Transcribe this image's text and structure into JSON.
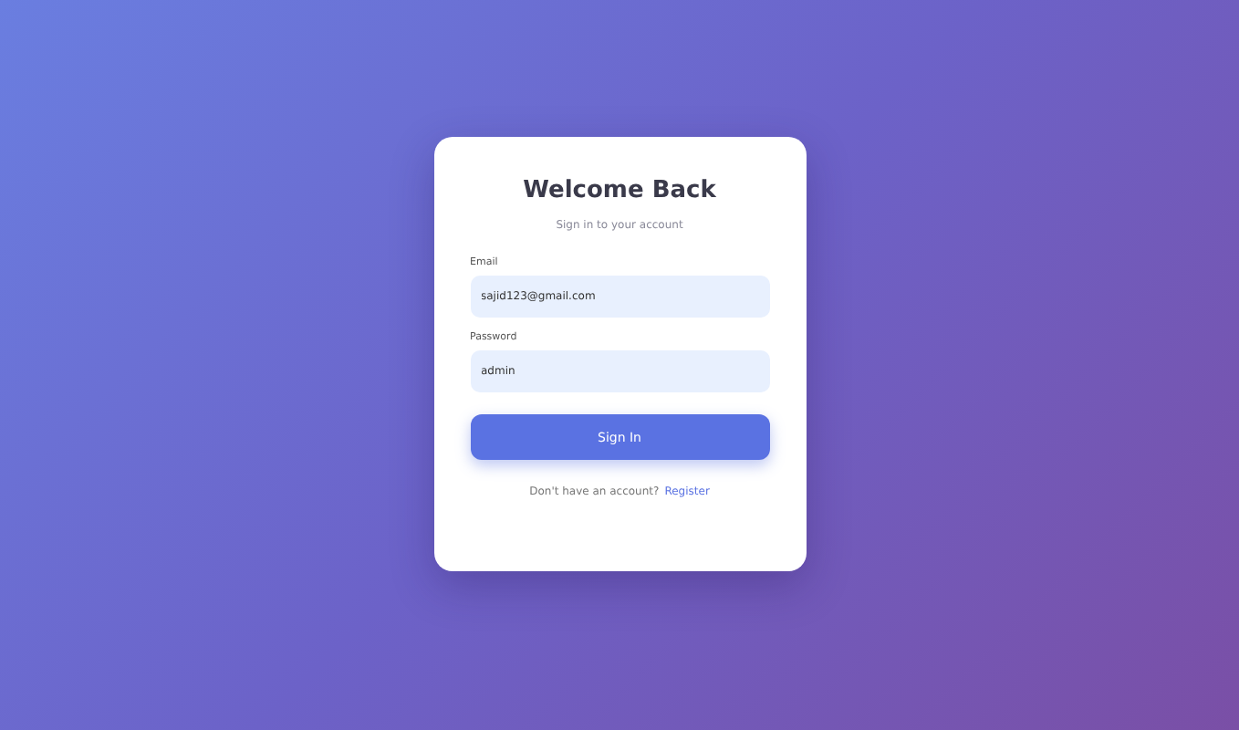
{
  "card": {
    "title": "Welcome Back",
    "subtitle": "Sign in to your account",
    "fields": [
      {
        "label": "Email",
        "value": "sajid123@gmail.com"
      },
      {
        "label": "Password",
        "value": "admin"
      }
    ],
    "submit": "Sign In",
    "footer_text": "Don't have an account?",
    "footer_link": "Register"
  }
}
